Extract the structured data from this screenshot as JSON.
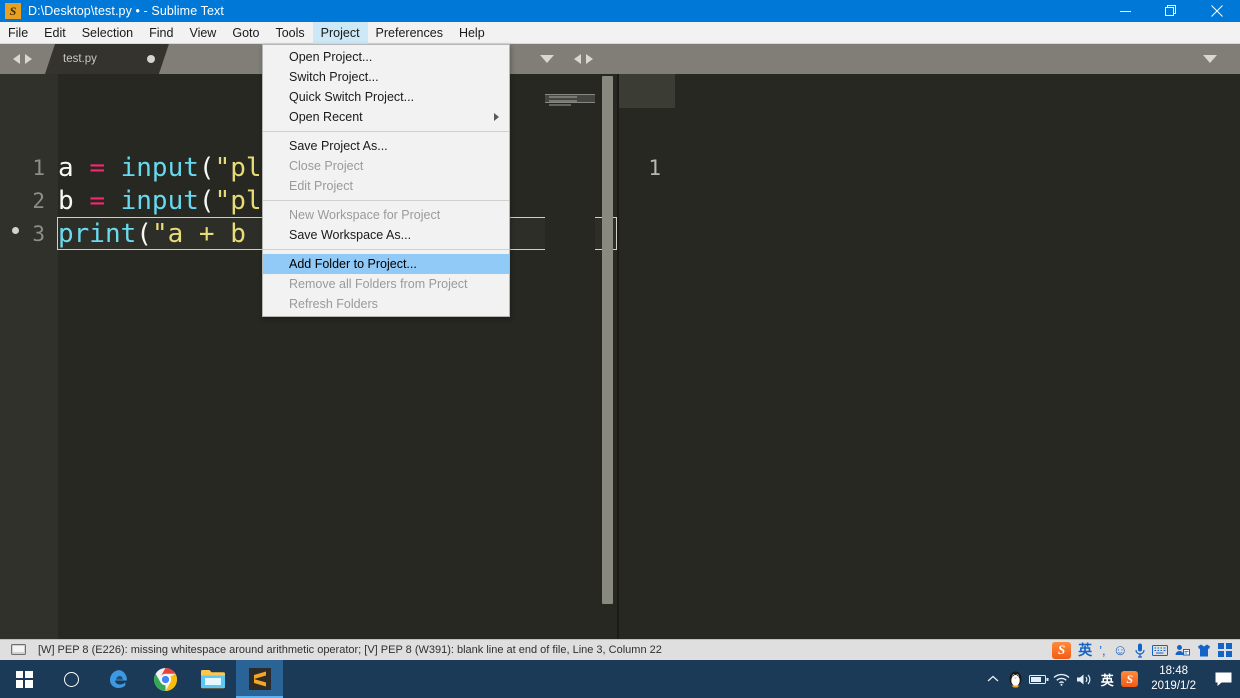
{
  "window": {
    "title": "D:\\Desktop\\test.py • - Sublime Text",
    "app_icon": "sublime-logo-icon",
    "minimize_label": "Minimize",
    "maximize_label": "Restore",
    "close_label": "Close",
    "accent_color": "#0078d7"
  },
  "menubar": {
    "items": [
      {
        "label": "File",
        "active": false
      },
      {
        "label": "Edit",
        "active": false
      },
      {
        "label": "Selection",
        "active": false
      },
      {
        "label": "Find",
        "active": false
      },
      {
        "label": "View",
        "active": false
      },
      {
        "label": "Goto",
        "active": false
      },
      {
        "label": "Tools",
        "active": false
      },
      {
        "label": "Project",
        "active": true
      },
      {
        "label": "Preferences",
        "active": false
      },
      {
        "label": "Help",
        "active": false
      }
    ]
  },
  "project_menu": {
    "highlight_color": "#91c9f7",
    "items": [
      {
        "label": "Open Project...",
        "disabled": false,
        "highlight": false,
        "submenu": false,
        "separator_after": false
      },
      {
        "label": "Switch Project...",
        "disabled": false,
        "highlight": false,
        "submenu": false,
        "separator_after": false
      },
      {
        "label": "Quick Switch Project...",
        "disabled": false,
        "highlight": false,
        "submenu": false,
        "separator_after": false
      },
      {
        "label": "Open Recent",
        "disabled": false,
        "highlight": false,
        "submenu": true,
        "separator_after": true
      },
      {
        "label": "Save Project As...",
        "disabled": false,
        "highlight": false,
        "submenu": false,
        "separator_after": false
      },
      {
        "label": "Close Project",
        "disabled": true,
        "highlight": false,
        "submenu": false,
        "separator_after": false
      },
      {
        "label": "Edit Project",
        "disabled": true,
        "highlight": false,
        "submenu": false,
        "separator_after": true
      },
      {
        "label": "New Workspace for Project",
        "disabled": true,
        "highlight": false,
        "submenu": false,
        "separator_after": false
      },
      {
        "label": "Save Workspace As...",
        "disabled": false,
        "highlight": false,
        "submenu": false,
        "separator_after": true
      },
      {
        "label": "Add Folder to Project...",
        "disabled": false,
        "highlight": true,
        "submenu": false,
        "separator_after": false
      },
      {
        "label": "Remove all Folders from Project",
        "disabled": true,
        "highlight": false,
        "submenu": false,
        "separator_after": false
      },
      {
        "label": "Refresh Folders",
        "disabled": true,
        "highlight": false,
        "submenu": false,
        "separator_after": false
      }
    ]
  },
  "editor": {
    "left_pane": {
      "tab": {
        "label": "test.py",
        "dirty": true
      },
      "nav_prev_icon": "chevron-left-icon",
      "nav_next_icon": "chevron-right-icon",
      "dropdown_icon": "chevron-down-icon",
      "lines": [
        {
          "number": "1",
          "bookmark": false,
          "current": false,
          "tokens": [
            {
              "text": "a",
              "type": "var"
            },
            {
              "text": " ",
              "type": "plain"
            },
            {
              "text": "=",
              "type": "op"
            },
            {
              "text": " ",
              "type": "plain"
            },
            {
              "text": "input",
              "type": "fn"
            },
            {
              "text": "(",
              "type": "paren"
            },
            {
              "text": "\"pl",
              "type": "str"
            }
          ]
        },
        {
          "number": "2",
          "bookmark": false,
          "current": false,
          "tokens": [
            {
              "text": "b",
              "type": "var"
            },
            {
              "text": " ",
              "type": "plain"
            },
            {
              "text": "=",
              "type": "op"
            },
            {
              "text": " ",
              "type": "plain"
            },
            {
              "text": "input",
              "type": "fn"
            },
            {
              "text": "(",
              "type": "paren"
            },
            {
              "text": "\"pl",
              "type": "str"
            }
          ]
        },
        {
          "number": "3",
          "bookmark": true,
          "current": true,
          "tokens": [
            {
              "text": "print",
              "type": "fn"
            },
            {
              "text": "(",
              "type": "paren"
            },
            {
              "text": "\"a + b",
              "type": "str"
            }
          ]
        }
      ]
    },
    "right_pane": {
      "dropdown_icon": "chevron-down-icon",
      "lines": [
        {
          "number": "1",
          "bookmark": false,
          "current": false,
          "tokens": []
        }
      ]
    }
  },
  "statusbar": {
    "display_icon": "monitor-icon",
    "message": "[W] PEP 8 (E226): missing whitespace around arithmetic operator; [V] PEP 8 (W391): blank line at end of file, Line 3, Column 22",
    "tray": [
      {
        "name": "sogou-logo-icon",
        "glyph": "S"
      },
      {
        "name": "ime-chinese-english-icon",
        "glyph": "英"
      },
      {
        "name": "ime-punctuation-icon",
        "glyph": "’,"
      },
      {
        "name": "ime-smiley-icon",
        "glyph": "☺"
      },
      {
        "name": "ime-voice-input-icon",
        "glyph": "🎤"
      },
      {
        "name": "ime-soft-keyboard-icon",
        "glyph": "⌨"
      },
      {
        "name": "ime-user-icon",
        "glyph": "👤"
      },
      {
        "name": "ime-skin-icon",
        "glyph": "👕"
      },
      {
        "name": "ime-toolbox-icon",
        "glyph": "⊞"
      }
    ]
  },
  "taskbar": {
    "background": "#1b3a57",
    "buttons": [
      {
        "name": "start-button",
        "label": "Start"
      },
      {
        "name": "cortana-search-button",
        "label": "Cortana"
      },
      {
        "name": "edge-button",
        "label": "Microsoft Edge"
      },
      {
        "name": "chrome-button",
        "label": "Google Chrome"
      },
      {
        "name": "file-explorer-button",
        "label": "File Explorer"
      },
      {
        "name": "sublime-text-button",
        "label": "Sublime Text",
        "active": true
      }
    ],
    "tray": [
      {
        "name": "show-hidden-icons-icon",
        "glyph": "⌃"
      },
      {
        "name": "qq-icon",
        "glyph": "🐧"
      },
      {
        "name": "battery-icon",
        "glyph": "battery"
      },
      {
        "name": "network-wifi-icon",
        "glyph": "wifi"
      },
      {
        "name": "volume-icon",
        "glyph": "volume"
      },
      {
        "name": "ime-language-icon",
        "glyph": "英"
      },
      {
        "name": "sogou-tray-icon",
        "glyph": "S"
      }
    ],
    "clock": {
      "time": "18:48",
      "date": "2019/1/2"
    },
    "action_center_icon": "action-center-icon"
  }
}
